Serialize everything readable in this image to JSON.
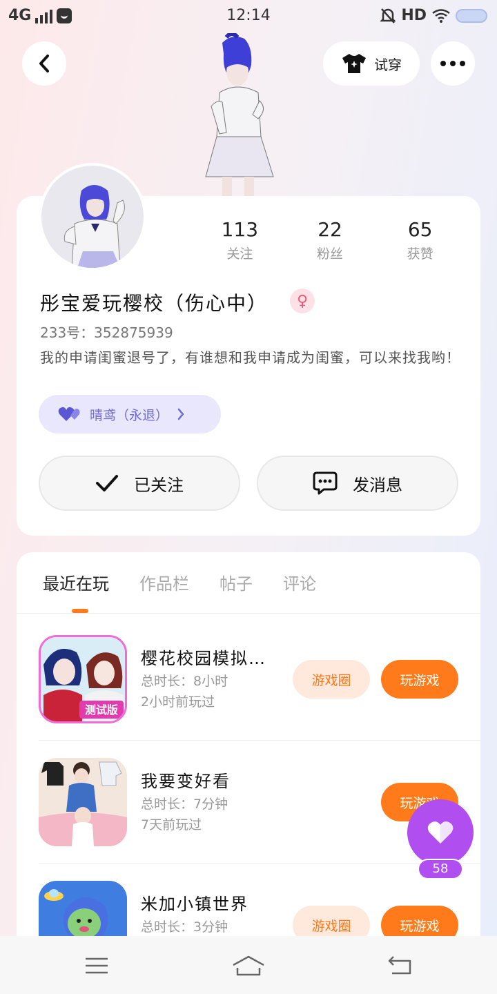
{
  "status_bar": {
    "network": "4G",
    "time": "12:14",
    "hd": "HD"
  },
  "header": {
    "try_on_label": "试穿"
  },
  "profile": {
    "stats": [
      {
        "value": "113",
        "label": "关注"
      },
      {
        "value": "22",
        "label": "粉丝"
      },
      {
        "value": "65",
        "label": "获赞"
      }
    ],
    "nickname": "彤宝爱玩樱校（伤心中）",
    "gender_symbol": "♀",
    "user_id": "233号：352875939",
    "bio": "我的申请闺蜜退号了，有谁想和我申请成为闺蜜，可以来找我哟！",
    "bestie_label": "晴鸢（永退）",
    "followed_label": "已关注",
    "message_label": "发消息"
  },
  "tabs": [
    {
      "label": "最近在玩",
      "active": true
    },
    {
      "label": "作品栏",
      "active": false
    },
    {
      "label": "帖子",
      "active": false
    },
    {
      "label": "评论",
      "active": false
    }
  ],
  "games": [
    {
      "title": "樱花校园模拟…",
      "duration": "总时长：8小时",
      "last_played": "2小时前玩过",
      "show_circle": true,
      "icon_badge": "测试版"
    },
    {
      "title": "我要变好看",
      "duration": "总时长：7分钟",
      "last_played": "7天前玩过",
      "show_circle": false
    },
    {
      "title": "米加小镇世界",
      "duration": "总时长：3分钟",
      "last_played": "",
      "show_circle": true
    }
  ],
  "game_buttons": {
    "circle_label": "游戏圈",
    "play_label": "玩游戏"
  },
  "like_count": "58",
  "colors": {
    "accent": "#ff7a1a",
    "like": "#b04ef0",
    "bestie": "#6f6bd6"
  }
}
